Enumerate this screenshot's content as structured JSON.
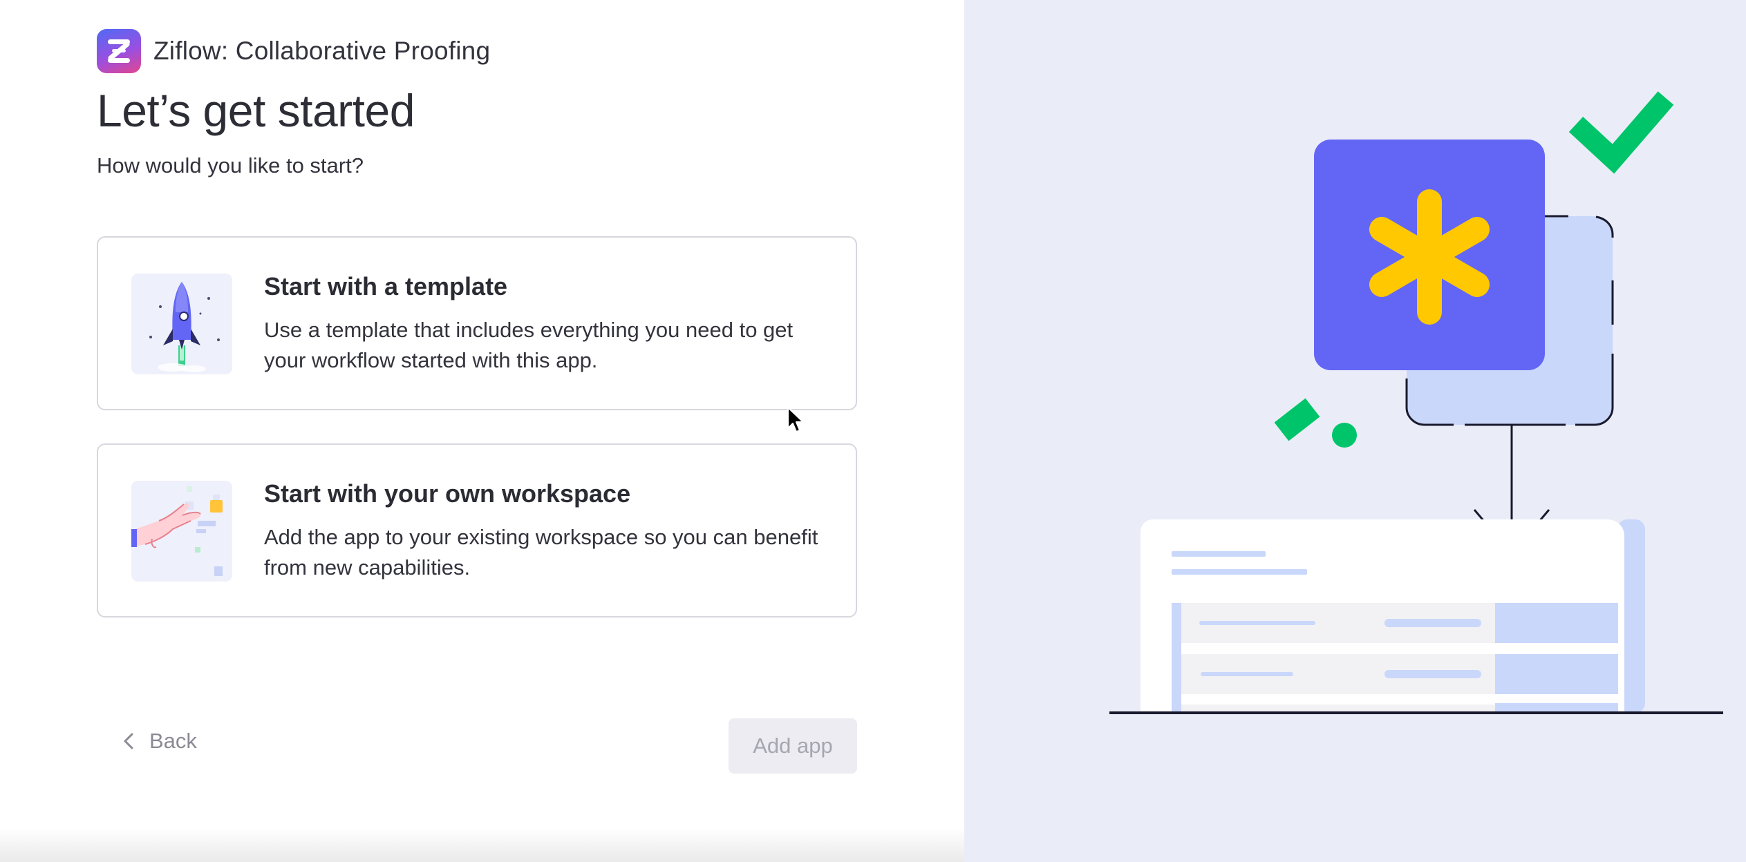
{
  "app": {
    "name": "Ziflow: Collaborative Proofing",
    "logo_icon": "ziflow-logo"
  },
  "page": {
    "title": "Let’s get started",
    "subtitle": "How would you like to start?"
  },
  "options": [
    {
      "title": "Start with a template",
      "description": "Use a template that includes everything you need to get your workflow started with this app.",
      "icon": "rocket-illustration"
    },
    {
      "title": "Start with your own workspace",
      "description": "Add the app to your existing workspace so you can benefit from new capabilities.",
      "icon": "hand-illustration"
    }
  ],
  "footer": {
    "back_label": "Back",
    "add_label": "Add app"
  },
  "illustration": {
    "name": "app-install-illustration",
    "colors": {
      "background": "#eaedf7",
      "tile": "#6366f5",
      "asterisk": "#ffc800",
      "check": "#00c46a",
      "shadow_tile": "#c9d7fa"
    }
  }
}
